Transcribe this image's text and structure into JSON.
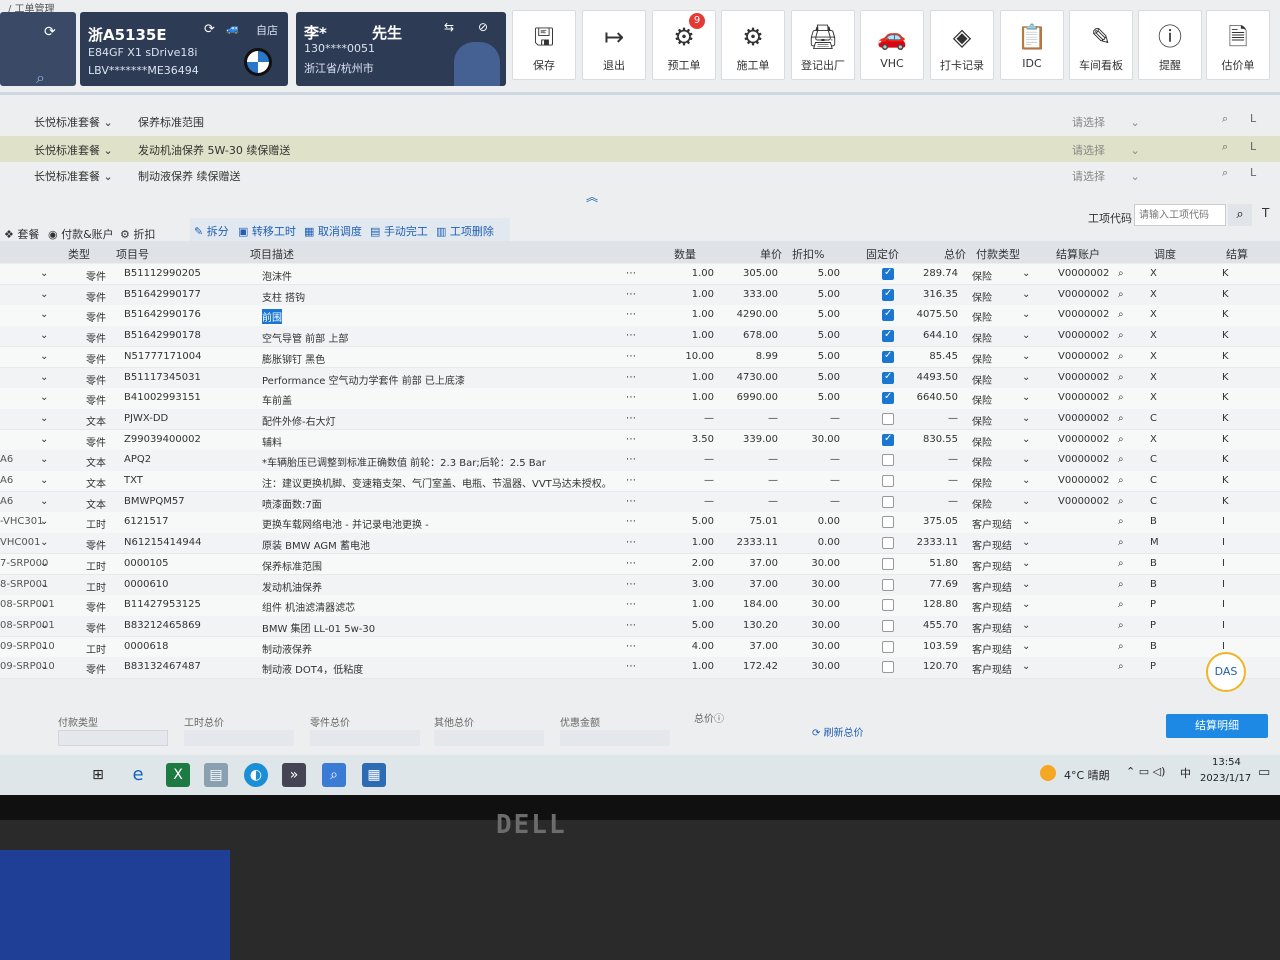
{
  "breadcrumb": "/ 工单管理",
  "vehicle": {
    "plate": "浙A5135E",
    "model": "E84GF  X1 sDrive18i",
    "vin": "LBV*******ME36494",
    "store": "自店"
  },
  "customer": {
    "name": "李*",
    "title": "先生",
    "phone": "130****0051",
    "location": "浙江省/杭州市"
  },
  "toolbar": [
    {
      "label": "保存",
      "icon": "save-icon",
      "glyph": "🖫"
    },
    {
      "label": "退出",
      "icon": "exit-icon",
      "glyph": "↦"
    },
    {
      "label": "预工单",
      "icon": "pre-order-icon",
      "glyph": "⚙",
      "badge": "9"
    },
    {
      "label": "施工单",
      "icon": "work-order-icon",
      "glyph": "⚙"
    },
    {
      "label": "登记出厂",
      "icon": "checkout-icon",
      "glyph": "🖨"
    },
    {
      "label": "VHC",
      "icon": "vhc-icon",
      "glyph": "🚗"
    },
    {
      "label": "打卡记录",
      "icon": "clock-record-icon",
      "glyph": "◈"
    },
    {
      "label": "IDC",
      "icon": "idc-icon",
      "glyph": "📋"
    },
    {
      "label": "车间看板",
      "icon": "board-icon",
      "glyph": "✎"
    },
    {
      "label": "提醒",
      "icon": "reminder-icon",
      "glyph": "ⓘ"
    },
    {
      "label": "估价单",
      "icon": "estimate-icon",
      "glyph": "🗎"
    }
  ],
  "packages": [
    {
      "select": "长悦标准套餐",
      "text": "保养标准范围",
      "pick": "请选择"
    },
    {
      "select": "长悦标准套餐",
      "text": "发动机油保养 5W-30 续保赠送",
      "pick": "请选择"
    },
    {
      "select": "长悦标准套餐",
      "text": "制动液保养 续保赠送",
      "pick": "请选择"
    }
  ],
  "tabs_left": [
    "套餐",
    "付款&账户",
    "折扣"
  ],
  "actions": [
    "拆分",
    "转移工时",
    "取消调度",
    "手动完工",
    "工项删除"
  ],
  "search": {
    "label": "工项代码",
    "placeholder": "请输入工项代码"
  },
  "columns": [
    "类型",
    "项目号",
    "项目描述",
    "数量",
    "单价",
    "折扣%",
    "固定价",
    "总价",
    "付款类型",
    "结算账户",
    "调度",
    "结算"
  ],
  "rows": [
    {
      "pre": "",
      "type": "零件",
      "code": "B51112990205",
      "desc": "泡沫件",
      "qty": "1.00",
      "price": "305.00",
      "disc": "5.00",
      "fixed": true,
      "total": "289.74",
      "pay": "保险",
      "acct": "V0000002",
      "sched": "X",
      "settle": "K"
    },
    {
      "pre": "",
      "type": "零件",
      "code": "B51642990177",
      "desc": "支柱 搭钩",
      "qty": "1.00",
      "price": "333.00",
      "disc": "5.00",
      "fixed": true,
      "total": "316.35",
      "pay": "保险",
      "acct": "V0000002",
      "sched": "X",
      "settle": "K"
    },
    {
      "pre": "",
      "type": "零件",
      "code": "B51642990176",
      "desc": "前围",
      "qty": "1.00",
      "price": "4290.00",
      "disc": "5.00",
      "fixed": true,
      "total": "4075.50",
      "pay": "保险",
      "acct": "V0000002",
      "sched": "X",
      "settle": "K",
      "hl": true
    },
    {
      "pre": "",
      "type": "零件",
      "code": "B51642990178",
      "desc": "空气导管 前部 上部",
      "qty": "1.00",
      "price": "678.00",
      "disc": "5.00",
      "fixed": true,
      "total": "644.10",
      "pay": "保险",
      "acct": "V0000002",
      "sched": "X",
      "settle": "K"
    },
    {
      "pre": "",
      "type": "零件",
      "code": "N51777171004",
      "desc": "膨胀铆钉 黑色",
      "qty": "10.00",
      "price": "8.99",
      "disc": "5.00",
      "fixed": true,
      "total": "85.45",
      "pay": "保险",
      "acct": "V0000002",
      "sched": "X",
      "settle": "K"
    },
    {
      "pre": "",
      "type": "零件",
      "code": "B51117345031",
      "desc": "Performance 空气动力学套件 前部 已上底漆",
      "qty": "1.00",
      "price": "4730.00",
      "disc": "5.00",
      "fixed": true,
      "total": "4493.50",
      "pay": "保险",
      "acct": "V0000002",
      "sched": "X",
      "settle": "K"
    },
    {
      "pre": "",
      "type": "零件",
      "code": "B41002993151",
      "desc": "车前盖",
      "qty": "1.00",
      "price": "6990.00",
      "disc": "5.00",
      "fixed": true,
      "total": "6640.50",
      "pay": "保险",
      "acct": "V0000002",
      "sched": "X",
      "settle": "K"
    },
    {
      "pre": "",
      "type": "文本",
      "code": "PJWX-DD",
      "desc": "配件外修-右大灯",
      "qty": "—",
      "price": "—",
      "disc": "—",
      "fixed": false,
      "total": "—",
      "pay": "保险",
      "acct": "V0000002",
      "sched": "C",
      "settle": "K"
    },
    {
      "pre": "",
      "type": "零件",
      "code": "Z99039400002",
      "desc": "辅料",
      "qty": "3.50",
      "price": "339.00",
      "disc": "30.00",
      "fixed": true,
      "total": "830.55",
      "pay": "保险",
      "acct": "V0000002",
      "sched": "X",
      "settle": "K"
    },
    {
      "pre": "A6",
      "type": "文本",
      "code": "APQ2",
      "desc": "*车辆胎压已调整到标准正确数值 前轮：2.3  Bar;后轮：2.5  Bar",
      "qty": "—",
      "price": "—",
      "disc": "—",
      "fixed": false,
      "total": "—",
      "pay": "保险",
      "acct": "V0000002",
      "sched": "C",
      "settle": "K"
    },
    {
      "pre": "A6",
      "type": "文本",
      "code": "TXT",
      "desc": "注：建议更换机脚、变速箱支架、气门室盖、电瓶、节温器、VVT马达未授权。",
      "qty": "—",
      "price": "—",
      "disc": "—",
      "fixed": false,
      "total": "—",
      "pay": "保险",
      "acct": "V0000002",
      "sched": "C",
      "settle": "K"
    },
    {
      "pre": "A6",
      "type": "文本",
      "code": "BMWPQM57",
      "desc": "喷漆面数:7面",
      "qty": "—",
      "price": "—",
      "disc": "—",
      "fixed": false,
      "total": "—",
      "pay": "保险",
      "acct": "V0000002",
      "sched": "C",
      "settle": "K"
    },
    {
      "pre": "-VHC301",
      "type": "工时",
      "code": "6121517",
      "desc": "更换车载网络电池 - 并记录电池更换 -",
      "qty": "5.00",
      "price": "75.01",
      "disc": "0.00",
      "fixed": false,
      "total": "375.05",
      "pay": "客户现结",
      "acct": "",
      "sched": "B",
      "settle": "I"
    },
    {
      "pre": "VHC001",
      "type": "零件",
      "code": "N61215414944",
      "desc": "原装 BMW AGM 蓄电池",
      "qty": "1.00",
      "price": "2333.11",
      "disc": "0.00",
      "fixed": false,
      "total": "2333.11",
      "pay": "客户现结",
      "acct": "",
      "sched": "M",
      "settle": "I"
    },
    {
      "pre": "7-SRP000",
      "type": "工时",
      "code": "0000105",
      "desc": "保养标准范围",
      "qty": "2.00",
      "price": "37.00",
      "disc": "30.00",
      "fixed": false,
      "total": "51.80",
      "pay": "客户现结",
      "acct": "",
      "sched": "B",
      "settle": "I"
    },
    {
      "pre": "8-SRP001",
      "type": "工时",
      "code": "0000610",
      "desc": "发动机油保养",
      "qty": "3.00",
      "price": "37.00",
      "disc": "30.00",
      "fixed": false,
      "total": "77.69",
      "pay": "客户现结",
      "acct": "",
      "sched": "B",
      "settle": "I"
    },
    {
      "pre": "08-SRP001",
      "type": "零件",
      "code": "B11427953125",
      "desc": "组件 机油滤清器滤芯",
      "qty": "1.00",
      "price": "184.00",
      "disc": "30.00",
      "fixed": false,
      "total": "128.80",
      "pay": "客户现结",
      "acct": "",
      "sched": "P",
      "settle": "I"
    },
    {
      "pre": "08-SRP001",
      "type": "零件",
      "code": "B83212465869",
      "desc": "BMW 集团 LL-01 5w-30",
      "qty": "5.00",
      "price": "130.20",
      "disc": "30.00",
      "fixed": false,
      "total": "455.70",
      "pay": "客户现结",
      "acct": "",
      "sched": "P",
      "settle": "I"
    },
    {
      "pre": "09-SRP010",
      "type": "工时",
      "code": "0000618",
      "desc": "制动液保养",
      "qty": "4.00",
      "price": "37.00",
      "disc": "30.00",
      "fixed": false,
      "total": "103.59",
      "pay": "客户现结",
      "acct": "",
      "sched": "B",
      "settle": "I"
    },
    {
      "pre": "09-SRP010",
      "type": "零件",
      "code": "B83132467487",
      "desc": "制动液 DOT4，低粘度",
      "qty": "1.00",
      "price": "172.42",
      "disc": "30.00",
      "fixed": false,
      "total": "120.70",
      "pay": "客户现结",
      "acct": "",
      "sched": "P",
      "settle": "I"
    }
  ],
  "footer": {
    "pay_type": "付款类型",
    "labor": "工时总价",
    "parts": "零件总价",
    "other": "其他总价",
    "discount": "优惠金额",
    "total": "总价ⓘ",
    "refresh": "刷新总价",
    "settle_btn": "结算明细"
  },
  "taskbar": {
    "weather": "4°C  晴朗",
    "ime": "中",
    "time": "13:54",
    "date": "2023/1/17"
  },
  "brand": "DELL",
  "das": "DAS"
}
